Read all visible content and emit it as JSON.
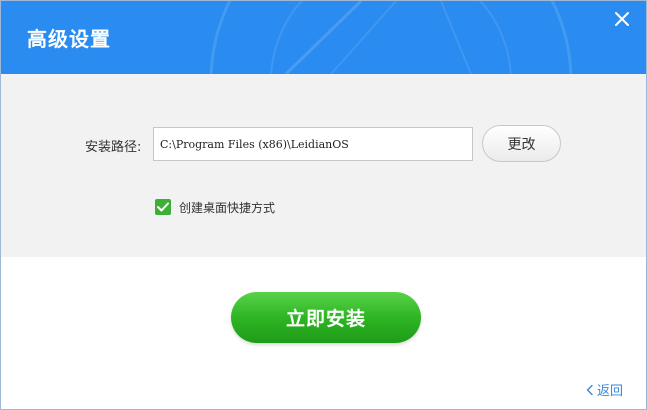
{
  "window": {
    "title": "高级设置"
  },
  "settings": {
    "path_label": "安装路径:",
    "path_value": "C:\\Program Files (x86)\\LeidianOS",
    "change_label": "更改",
    "shortcut_checked": true,
    "shortcut_label": "创建桌面快捷方式"
  },
  "actions": {
    "install_label": "立即安装",
    "back_label": "返回"
  },
  "icons": {
    "close": "close-icon",
    "check": "checkmark-icon",
    "back": "chevron-left-icon"
  },
  "colors": {
    "header": "#2a8cf0",
    "settings_bg": "#f2f2f2",
    "install_green": "#2eb524",
    "checkbox_green": "#3cb034",
    "link_blue": "#3a86d9"
  }
}
